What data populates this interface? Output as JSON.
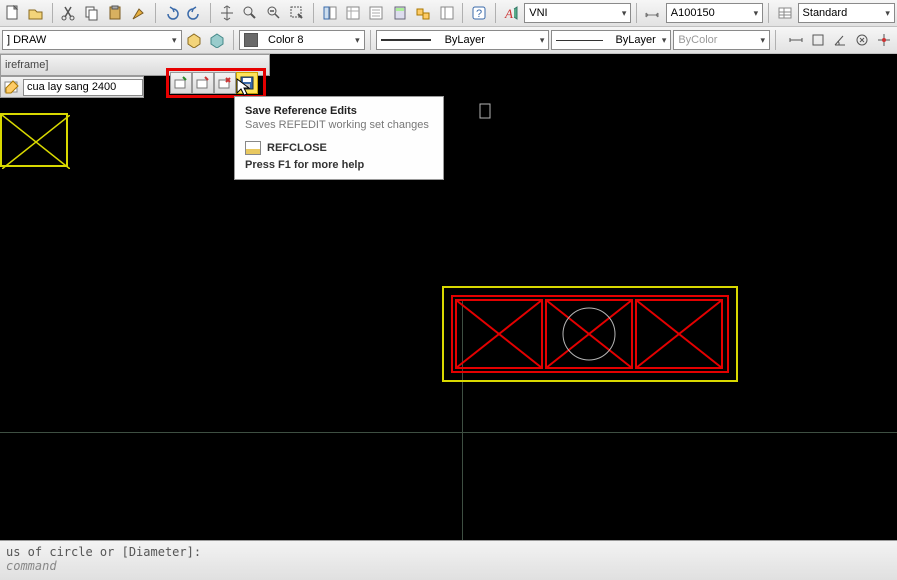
{
  "toolbar": {
    "font_dd": "VNI",
    "style_dd": "A100150",
    "std_dd": "Standard"
  },
  "row2": {
    "layer": "] DRAW",
    "color": "Color 8",
    "ltype": "ByLayer",
    "lweight": "ByLayer",
    "bycolor": "ByColor"
  },
  "ref": {
    "bar_label": "ireframe]",
    "block_name": "cua lay sang 2400"
  },
  "tooltip": {
    "title": "Save Reference Edits",
    "subtitle": "Saves REFEDIT working set changes",
    "command": "REFCLOSE",
    "help": "Press F1 for more help"
  },
  "cmd": {
    "line1": "us of circle or [Diameter]:",
    "line2": "command"
  }
}
